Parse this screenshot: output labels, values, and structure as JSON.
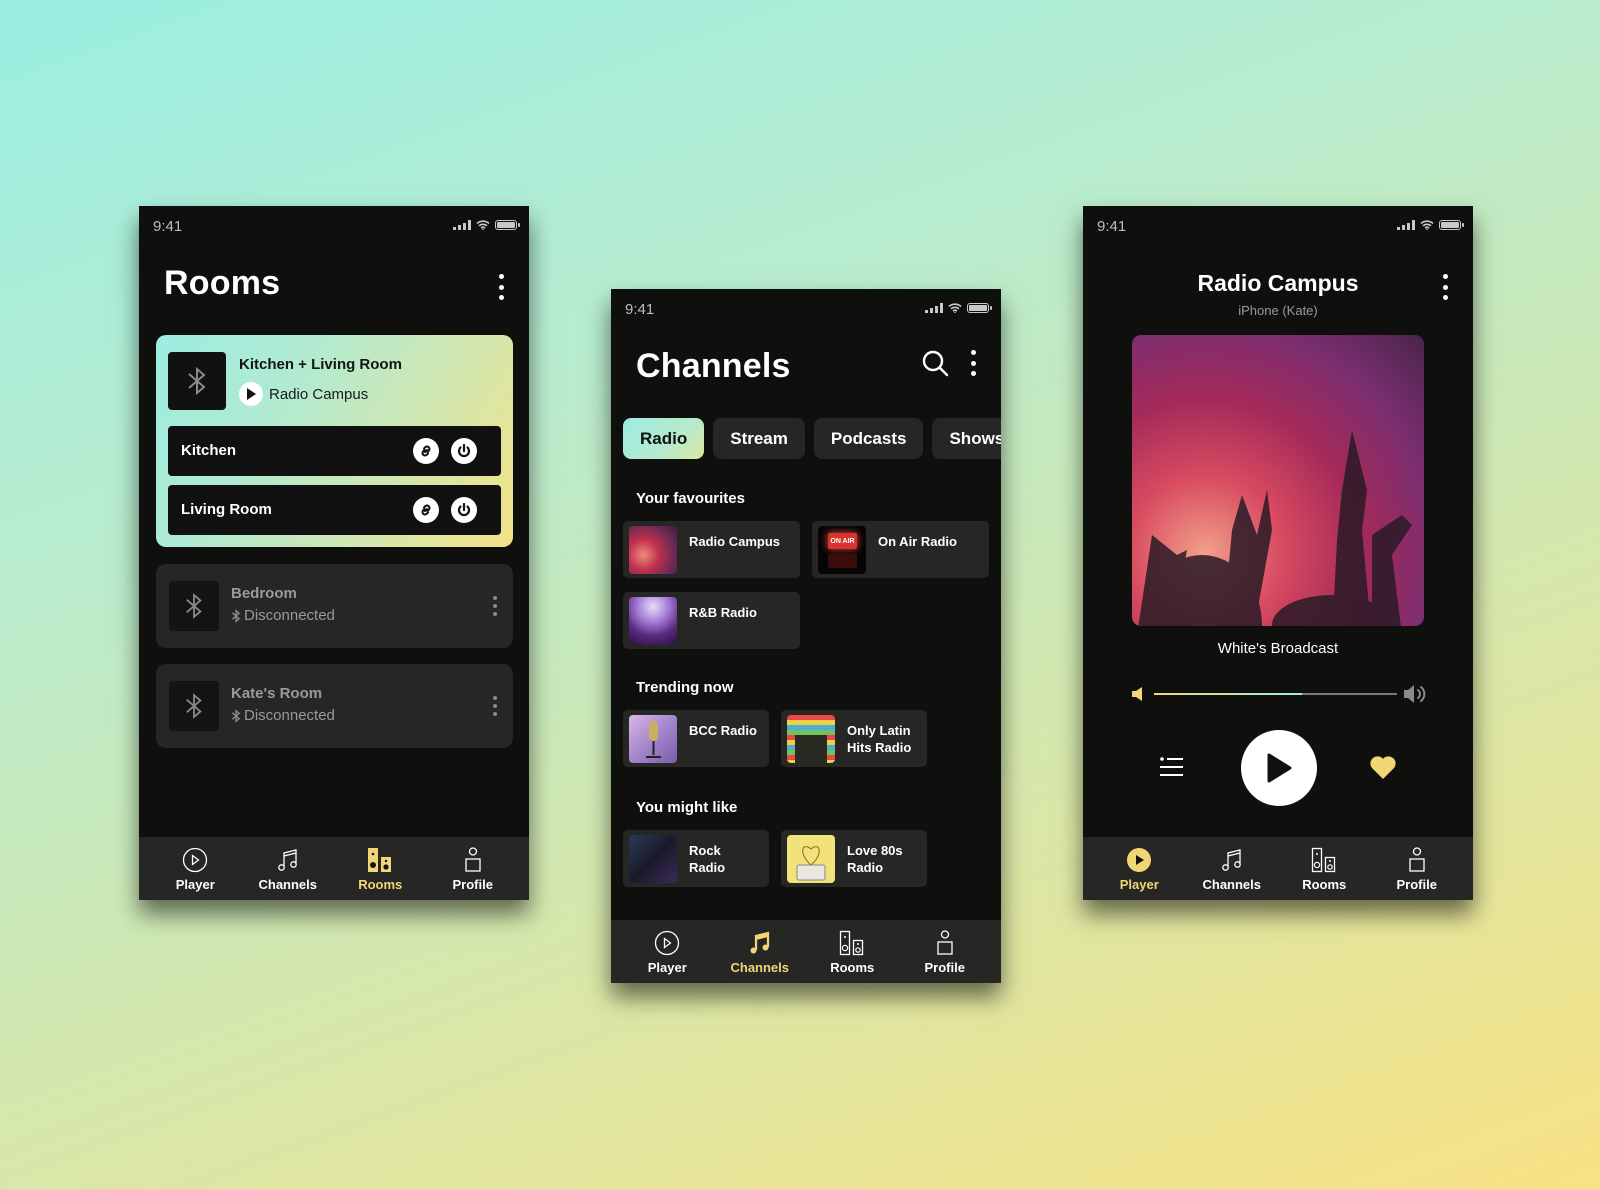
{
  "status_time": "9:41",
  "rooms_screen": {
    "title": "Rooms",
    "group": {
      "title": "Kitchen + Living Room",
      "now_playing": "Radio Campus",
      "rooms": [
        {
          "name": "Kitchen"
        },
        {
          "name": "Living Room"
        }
      ]
    },
    "rooms": [
      {
        "name": "Bedroom",
        "status": "Disconnected"
      },
      {
        "name": "Kate's Room",
        "status": "Disconnected"
      }
    ],
    "tabs": [
      {
        "label": "Player",
        "icon": "play-circle-icon",
        "active": false
      },
      {
        "label": "Channels",
        "icon": "music-note-icon",
        "active": false
      },
      {
        "label": "Rooms",
        "icon": "speakers-icon",
        "active": true
      },
      {
        "label": "Profile",
        "icon": "person-icon",
        "active": false
      }
    ]
  },
  "channels_screen": {
    "title": "Channels",
    "chips": [
      {
        "label": "Radio",
        "active": true
      },
      {
        "label": "Stream",
        "active": false
      },
      {
        "label": "Podcasts",
        "active": false
      },
      {
        "label": "Shows",
        "active": false
      }
    ],
    "sections": [
      {
        "title": "Your favourites",
        "items": [
          "Radio Campus",
          "On Air Radio",
          "R&B Radio"
        ]
      },
      {
        "title": "Trending now",
        "items": [
          "BCC Radio",
          "Only Latin\nHits Radio"
        ]
      },
      {
        "title": "You might like",
        "items": [
          "Rock\nRadio",
          "Love 80s\nRadio"
        ]
      }
    ],
    "onair_thumb_text": "ON AIR",
    "tabs": [
      {
        "label": "Player",
        "active": false
      },
      {
        "label": "Channels",
        "active": true
      },
      {
        "label": "Rooms",
        "active": false
      },
      {
        "label": "Profile",
        "active": false
      }
    ]
  },
  "player_screen": {
    "title": "Radio Campus",
    "device": "iPhone (Kate)",
    "track": "White's Broadcast",
    "volume_fraction": 0.61,
    "favourite": true,
    "tabs": [
      {
        "label": "Player",
        "active": true
      },
      {
        "label": "Channels",
        "active": false
      },
      {
        "label": "Rooms",
        "active": false
      },
      {
        "label": "Profile",
        "active": false
      }
    ]
  },
  "colors": {
    "accent_yellow": "#f2d675",
    "accent_mint": "#9cede2",
    "surface": "#262624",
    "background": "#0f0f0e"
  }
}
